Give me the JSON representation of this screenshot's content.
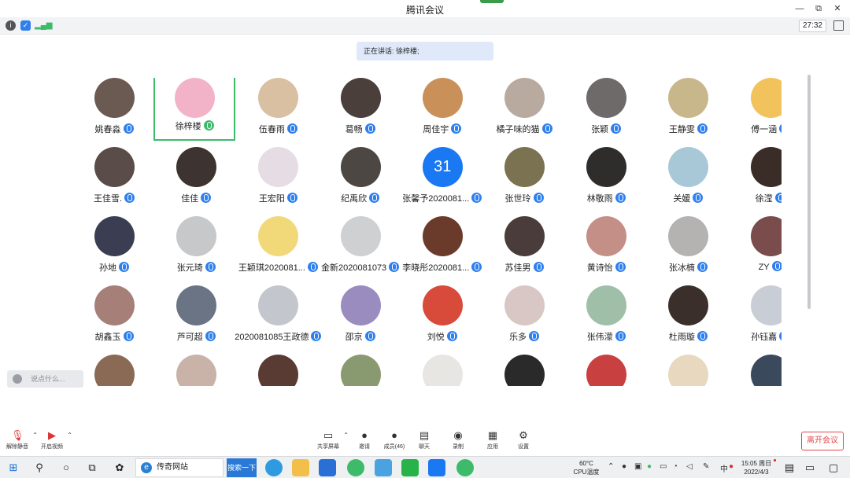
{
  "window": {
    "title": "腾讯会议",
    "minimize": "—",
    "maximize": "⧉",
    "close": "✕"
  },
  "infobar": {
    "timer": "27:32"
  },
  "speaking": {
    "label": "正在讲话: 徐梓楼;"
  },
  "participants": [
    {
      "name": "姚春淼",
      "color": "#6b5a52"
    },
    {
      "name": "徐梓楼",
      "color": "#f2b3c8",
      "active": true
    },
    {
      "name": "伍春雨",
      "color": "#d9c0a3"
    },
    {
      "name": "葛畅",
      "color": "#4a3f3b"
    },
    {
      "name": "周佳宇",
      "color": "#c9905a"
    },
    {
      "name": "橘子味的猫",
      "color": "#b9aaa0"
    },
    {
      "name": "张颖",
      "color": "#6e6a6a"
    },
    {
      "name": "王静雯",
      "color": "#c8b78a"
    },
    {
      "name": "傅一涵",
      "color": "#f2c25c"
    },
    {
      "name": "王佳雪.",
      "color": "#5a4c48"
    },
    {
      "name": "佳佳",
      "color": "#3d3330"
    },
    {
      "name": "王宏阳",
      "color": "#e6dce3"
    },
    {
      "name": "纪禹欣",
      "color": "#4c4743"
    },
    {
      "name": "张馨予2020081...",
      "color": "#1a78f2",
      "calendar": "31"
    },
    {
      "name": "张世玲",
      "color": "#7a7250"
    },
    {
      "name": "林敬雨",
      "color": "#2f2c2c"
    },
    {
      "name": "关媛",
      "color": "#a8c8d8"
    },
    {
      "name": "徐滢",
      "color": "#3a2c26"
    },
    {
      "name": "孙地",
      "color": "#3b3d52"
    },
    {
      "name": "张元琦",
      "color": "#c7c8ca"
    },
    {
      "name": "王颖琪2020081...",
      "color": "#f1d97a"
    },
    {
      "name": "金新2020081073",
      "color": "#cfd0d2"
    },
    {
      "name": "李晓彤2020081...",
      "color": "#6a3b2a"
    },
    {
      "name": "苏佳男",
      "color": "#4a3c3a"
    },
    {
      "name": "黄诗怡",
      "color": "#c48f86"
    },
    {
      "name": "张冰楠",
      "color": "#b5b3b2"
    },
    {
      "name": "ZY",
      "color": "#7a4c4c"
    },
    {
      "name": "胡鑫玉",
      "color": "#a67f78"
    },
    {
      "name": "芦可超",
      "color": "#6a7484"
    },
    {
      "name": "2020081085王政德",
      "color": "#c3c6cc"
    },
    {
      "name": "邵京",
      "color": "#9b8cc0"
    },
    {
      "name": "刘悦",
      "color": "#d84a3a"
    },
    {
      "name": "乐多",
      "color": "#d8c7c4"
    },
    {
      "name": "张伟濛",
      "color": "#9fbfa8"
    },
    {
      "name": "杜雨璇",
      "color": "#3a2f2a"
    },
    {
      "name": "孙钰嘉",
      "color": "#c9cdd6"
    },
    {
      "name": "",
      "color": "#8a6a55"
    },
    {
      "name": "",
      "color": "#c9b3a8"
    },
    {
      "name": "",
      "color": "#5a3b33"
    },
    {
      "name": "",
      "color": "#8a9a70"
    },
    {
      "name": "",
      "color": "#e8e6e2"
    },
    {
      "name": "",
      "color": "#2a2a2a"
    },
    {
      "name": "",
      "color": "#c94040"
    },
    {
      "name": "",
      "color": "#e8d8c0"
    },
    {
      "name": "",
      "color": "#3a4a5c"
    }
  ],
  "chat_input": {
    "placeholder": "说点什么..."
  },
  "toolbar": {
    "mute": "解除静音",
    "video": "开启视频",
    "share": "共享屏幕",
    "invite": "邀请",
    "members": "成员(46)",
    "chat": "聊天",
    "record": "录制",
    "apps": "应用",
    "settings": "设置",
    "leave": "离开会议"
  },
  "taskbar": {
    "browser_item": "传奇网站",
    "search_button": "搜索一下",
    "cpu_temp": "60°C",
    "cpu_label": "CPU温度",
    "time": "15:05 周日",
    "date": "2022/4/3"
  }
}
